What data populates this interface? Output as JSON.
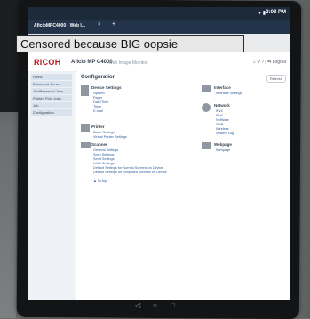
{
  "status": {
    "time": "3:08 PM",
    "icons": "▾ ▮"
  },
  "tab": {
    "title": "AficioMPC4000 - Web I...",
    "close": "×",
    "new": "+"
  },
  "censor": {
    "text": "Censored because BIG oopsie"
  },
  "app": {
    "brand": "RICOH",
    "model": "Aficio MP C4000",
    "subtitle": "Web Image Monitor",
    "header_buttons": "⌂  ⚲  ?  |  ⇆ Logout"
  },
  "sidebar": {
    "items": [
      {
        "label": "Home"
      },
      {
        "label": "Document Server"
      },
      {
        "label": "Job/Reserved Jobs"
      },
      {
        "label": "Printer: Print Jobs"
      },
      {
        "label": "Job"
      },
      {
        "label": "Configuration"
      }
    ]
  },
  "page": {
    "title": "Configuration",
    "refresh": "Refresh"
  },
  "sections": {
    "device": {
      "title": "Device Settings",
      "links": [
        "System",
        "Paper",
        "Date/Time",
        "Timer",
        "E-mail"
      ]
    },
    "interface": {
      "title": "Interface",
      "links": [
        "Interface Settings"
      ]
    },
    "network": {
      "title": "Network",
      "links": [
        "IPv4",
        "IPv6",
        "NetWare",
        "SMB",
        "Wireless",
        "System Log"
      ]
    },
    "printer": {
      "title": "Printer",
      "links": [
        "Basic Settings",
        "Virtual Printer Settings"
      ]
    },
    "scanner": {
      "title": "Scanner",
      "links": [
        "General Settings",
        "Scan Settings",
        "Send Settings",
        "Initial Settings",
        "Default Settings for Normal Screens on Device",
        "Default Settings for Simplified Screens on Device"
      ]
    },
    "webpage": {
      "title": "Webpage",
      "links": [
        "Webpage"
      ]
    },
    "footer": "▲ To top"
  },
  "nav": {
    "back": "◁",
    "home": "○",
    "recent": "□"
  }
}
